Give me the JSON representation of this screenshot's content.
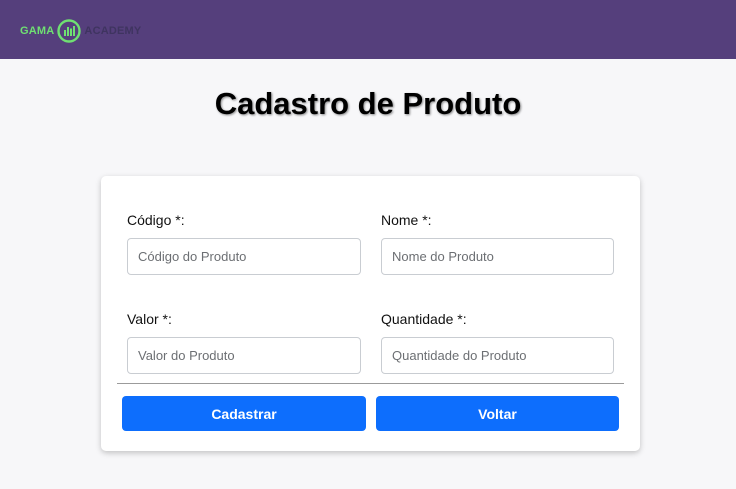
{
  "header": {
    "logo": {
      "left_text": "GAMA",
      "right_text": "ACADEMY",
      "icon": "gama-bars-circle-icon"
    },
    "colors": {
      "bar": "#553f7c",
      "logo_green": "#6fe072"
    }
  },
  "page": {
    "title": "Cadastro de Produto"
  },
  "form": {
    "codigo": {
      "label": "Código *:",
      "placeholder": "Código do Produto",
      "value": ""
    },
    "nome": {
      "label": "Nome *:",
      "placeholder": "Nome do Produto",
      "value": ""
    },
    "valor": {
      "label": "Valor *:",
      "placeholder": "Valor do Produto",
      "value": ""
    },
    "quantidade": {
      "label": "Quantidade *:",
      "placeholder": "Quantidade do Produto",
      "value": ""
    }
  },
  "actions": {
    "submit_label": "Cadastrar",
    "back_label": "Voltar",
    "button_color": "#0d6efd"
  }
}
